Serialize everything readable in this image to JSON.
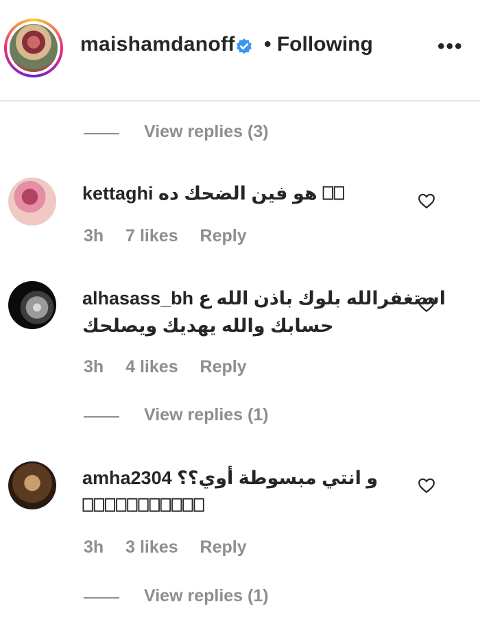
{
  "header": {
    "username": "maishamdanoff",
    "following_label": "• Following",
    "more_label": "•••"
  },
  "thread": [
    {
      "type": "replies",
      "label": "View replies (3)"
    },
    {
      "type": "comment",
      "username": "kettaghi",
      "text_line1": "هو فين الضحك ده ⎕⎕",
      "text_line2": "",
      "time": "3h",
      "likes": "7 likes",
      "reply": "Reply"
    },
    {
      "type": "comment",
      "username": "alhasass_bh",
      "text_line1": "استغفرالله بلوك باذن الله ع",
      "text_line2": "حسابك والله يهديك ويصلحك",
      "time": "3h",
      "likes": "4 likes",
      "reply": "Reply"
    },
    {
      "type": "replies",
      "label": "View replies (1)"
    },
    {
      "type": "comment",
      "username": "amha2304",
      "text_line1": "و انتي مبسوطة أوي؟؟",
      "text_line2": "⎕⎕⎕⎕⎕⎕⎕⎕⎕⎕⎕",
      "time": "3h",
      "likes": "3 likes",
      "reply": "Reply"
    },
    {
      "type": "replies",
      "label": "View replies (1)"
    }
  ],
  "colors": {
    "text": "#262626",
    "muted": "#8e8e8e",
    "verified": "#3897f0",
    "divider": "#e6e6e6"
  }
}
